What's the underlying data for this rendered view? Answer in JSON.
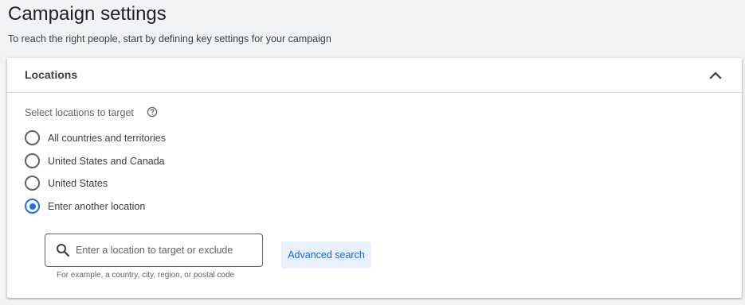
{
  "header": {
    "title": "Campaign settings",
    "subtitle": "To reach the right people, start by defining key settings for your campaign"
  },
  "locations": {
    "title": "Locations",
    "collapse_icon": "chevron-up-icon",
    "select_label": "Select locations to target",
    "help_icon": "help-circle-icon",
    "options": [
      {
        "label": "All countries and territories",
        "checked": false
      },
      {
        "label": "United States and Canada",
        "checked": false
      },
      {
        "label": "United States",
        "checked": false
      },
      {
        "label": "Enter another location",
        "checked": true
      }
    ],
    "search": {
      "placeholder": "Enter a location to target or exclude",
      "value": "",
      "icon": "search-icon",
      "hint": "For example, a country, city, region, or postal code"
    },
    "advanced_search_label": "Advanced search"
  },
  "colors": {
    "accent": "#1a73e8",
    "advanced_button_bg": "#e8f0fe",
    "page_bg": "#f1f3f4"
  }
}
